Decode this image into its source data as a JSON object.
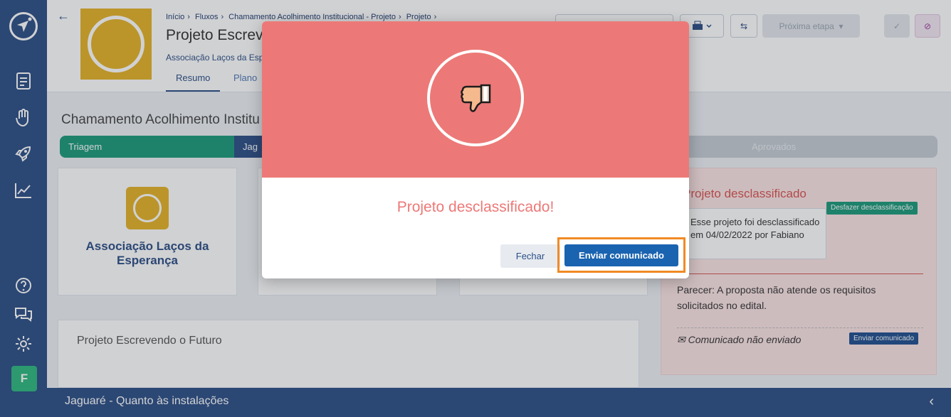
{
  "breadcrumb": [
    "Início",
    "Fluxos",
    "Chamamento Acolhimento Institucional - Projeto",
    "Projeto"
  ],
  "project": {
    "title": "Projeto Escrev",
    "org": "Associação Laços da Esp",
    "tabs": [
      "Resumo",
      "Plano"
    ]
  },
  "header_buttons": {
    "next_stage": "Próxima etapa"
  },
  "main": {
    "title": "Chamamento Acolhimento Institu",
    "pipeline": [
      "Triagem",
      "Jag",
      "Aprovados"
    ],
    "org_card_name": "Associação Laços da Esperança",
    "section2_title": "Projeto Escrevendo o Futuro"
  },
  "right_panel": {
    "title": "Projeto desclassificado",
    "box_text": "Esse projeto foi desclassificado em 04/02/2022 por Fabiano",
    "undo_label": "Desfazer desclassificação",
    "parecer": "Parecer: A proposta não atende os requisitos solicitados no edital.",
    "status": "Comunicado não enviado",
    "send_label": "Enviar comunicado"
  },
  "footer": {
    "text": "Jaguaré - Quanto às instalações"
  },
  "user": {
    "initial": "F"
  },
  "modal": {
    "message": "Projeto desclassificado!",
    "close_label": "Fechar",
    "send_label": "Enviar comunicado",
    "icon": "thumbs-down-icon",
    "colors": {
      "header": "#ec7977",
      "primary": "#1a63b0",
      "highlight": "#f08a24"
    }
  }
}
